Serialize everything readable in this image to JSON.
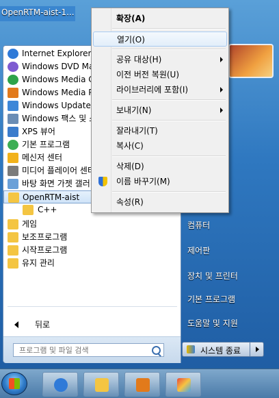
{
  "desktop": {
    "icon_label": "OpenRTM-aist-1..."
  },
  "programs": [
    {
      "label": "Internet Explorer",
      "color": "#2f7ad8"
    },
    {
      "label": "Windows DVD Maker",
      "color": "#7e5bd1"
    },
    {
      "label": "Windows Media Center",
      "color": "#2ea34a"
    },
    {
      "label": "Windows Media Player",
      "color": "#e27a1b"
    },
    {
      "label": "Windows Update",
      "color": "#3d87d8"
    },
    {
      "label": "Windows 팩스 및 스캔",
      "color": "#6a8db5"
    },
    {
      "label": "XPS 뷰어",
      "color": "#3a7ccc"
    },
    {
      "label": "기본 프로그램",
      "color": "#3cae54"
    },
    {
      "label": "메신저 센터",
      "color": "#f2b21b"
    },
    {
      "label": "미디어 플레이어 센터",
      "color": "#7b7b7b"
    },
    {
      "label": "바탕 화면 가젯 갤러리",
      "color": "#6aa0d8"
    },
    {
      "label": "OpenRTM-aist",
      "color": "#f4c542"
    },
    {
      "label": "C++",
      "color": "#f4c542"
    },
    {
      "label": "게임",
      "color": "#f4c542"
    },
    {
      "label": "보조프로그램",
      "color": "#f4c542"
    },
    {
      "label": "시작프로그램",
      "color": "#f4c542"
    },
    {
      "label": "유지 관리",
      "color": "#f4c542"
    }
  ],
  "back_label": "뒤로",
  "search": {
    "placeholder": "프로그램 및 파일 검색"
  },
  "right_links": [
    "컴퓨터",
    "제어판",
    "장치 및 프린터",
    "기본 프로그램",
    "도움말 및 지원"
  ],
  "shutdown_label": "시스템 종료",
  "context_menu": [
    {
      "label": "확장(A)",
      "bold": true
    },
    {
      "label": "열기(O)",
      "highlight": true
    },
    {
      "label": "공유 대상(H)",
      "submenu": true
    },
    {
      "label": "이전 버전 복원(U)"
    },
    {
      "label": "라이브러리에 포함(I)",
      "submenu": true
    },
    {
      "label": "보내기(N)",
      "submenu": true
    },
    {
      "label": "잘라내기(T)"
    },
    {
      "label": "복사(C)"
    },
    {
      "label": "삭제(D)"
    },
    {
      "label": "이름 바꾸기(M)",
      "icon": "shield-icon"
    },
    {
      "label": "속성(R)"
    }
  ],
  "taskbar": {
    "items": [
      "internet-explorer",
      "file-explorer",
      "media-player",
      "paint"
    ]
  }
}
